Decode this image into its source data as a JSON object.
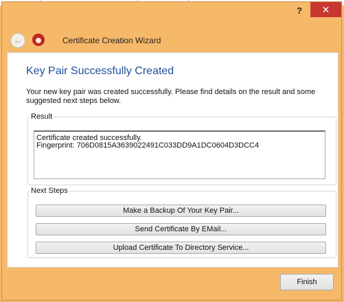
{
  "window": {
    "help_label": "?",
    "close_label": "✕"
  },
  "nav": {
    "back_label": "←",
    "title": "Certificate Creation Wizard"
  },
  "page": {
    "heading": "Key Pair Successfully Created",
    "intro": "Your new key pair was created successfully. Please find details on the result and some suggested next steps below."
  },
  "result": {
    "legend": "Result",
    "line1": "Certificate created successfully.",
    "line2": "Fingerprint: 706D0815A3639022491C033DD9A1DC0604D3DCC4"
  },
  "next_steps": {
    "legend": "Next Steps",
    "buttons": [
      "Make a Backup Of Your Key Pair...",
      "Send Certificate By EMail...",
      "Upload Certificate To Directory Service..."
    ]
  },
  "footer": {
    "finish_label": "Finish"
  },
  "colors": {
    "window_frame": "#f6b96a",
    "heading_blue": "#1f4f99",
    "close_red": "#c7372f"
  },
  "icons": {
    "back": "back-arrow-icon",
    "app": "kleopatra-app-icon"
  }
}
